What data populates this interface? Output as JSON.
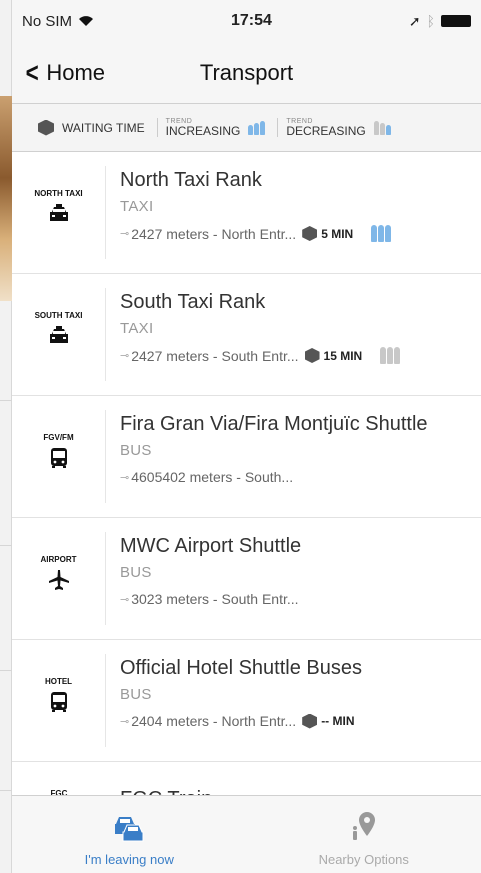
{
  "status_bar": {
    "carrier": "No SIM",
    "time": "17:54"
  },
  "nav": {
    "back_label": "Home",
    "title": "Transport"
  },
  "legend": {
    "waiting_time": "WAITING TIME",
    "trend_small": "TREND",
    "increasing": "INCREASING",
    "decreasing": "DECREASING"
  },
  "rows": [
    {
      "code": "NORTH TAXI",
      "icon": "taxi-icon",
      "name": "North Taxi Rank",
      "type": "TAXI",
      "distance": "2427 meters - North Entr...",
      "wait": "5 MIN",
      "trend": "increasing"
    },
    {
      "code": "SOUTH TAXI",
      "icon": "taxi-icon",
      "name": "South Taxi Rank",
      "type": "TAXI",
      "distance": "2427 meters - South Entr...",
      "wait": "15 MIN",
      "trend": "decreasing"
    },
    {
      "code": "FGV/FM",
      "icon": "bus-icon",
      "name": "Fira Gran Via/Fira Montjuïc Shuttle",
      "type": "BUS",
      "distance": "4605402 meters - South..."
    },
    {
      "code": "AIRPORT",
      "icon": "airplane-icon",
      "name": "MWC Airport Shuttle",
      "type": "BUS",
      "distance": "3023 meters - South Entr..."
    },
    {
      "code": "HOTEL",
      "icon": "bus-icon",
      "name": "Official Hotel Shuttle Buses",
      "type": "BUS",
      "distance": "2404 meters - North Entr...",
      "wait": "-- MIN"
    }
  ],
  "partial_row": {
    "code": "FGC",
    "name": "FGC Train"
  },
  "tabs": [
    {
      "label": "I'm leaving now",
      "icon": "cars-icon",
      "active": true
    },
    {
      "label": "Nearby Options",
      "icon": "location-pin-icon",
      "active": false
    }
  ],
  "colors": {
    "accent": "#3a7ec7",
    "trend_blue": "#7fb7e8",
    "trend_grey": "#c8c8c8"
  }
}
